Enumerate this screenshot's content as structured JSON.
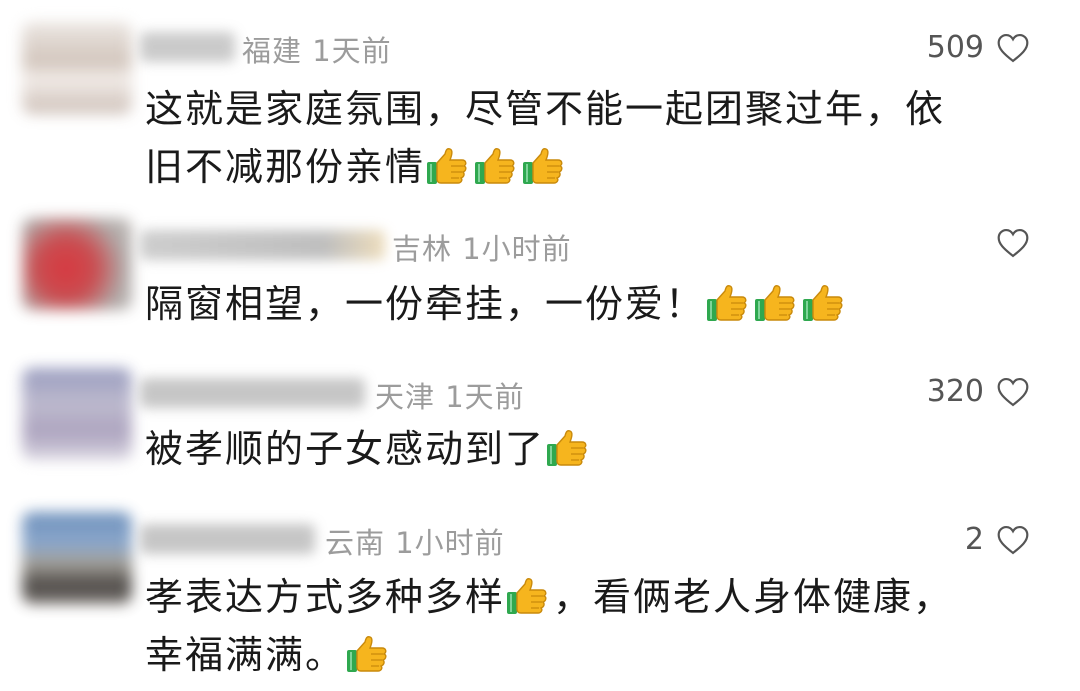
{
  "icons": {
    "like": "heart-outline-icon",
    "emoji": "thumbs-up-emoji-icon"
  },
  "comments": [
    {
      "location": "福建",
      "time": "1天前",
      "likes": "509",
      "text_lines": [
        "这就是家庭氛围，尽管不能一起团聚过年，依",
        "旧不减那份亲情"
      ],
      "emoji_count": 3
    },
    {
      "location": "吉林",
      "time": "1小时前",
      "likes": "",
      "text_lines": [
        "隔窗相望，一份牵挂，一份爱！"
      ],
      "emoji_count": 3
    },
    {
      "location": "天津",
      "time": "1天前",
      "likes": "320",
      "text_lines": [
        "被孝顺的子女感动到了"
      ],
      "emoji_count": 1
    },
    {
      "location": "云南",
      "time": "1小时前",
      "likes": "2",
      "text_lines": [
        "孝表达方式多种多样",
        "，看俩老人身体健康，",
        "幸福满满。"
      ],
      "emoji_count": 1
    }
  ]
}
